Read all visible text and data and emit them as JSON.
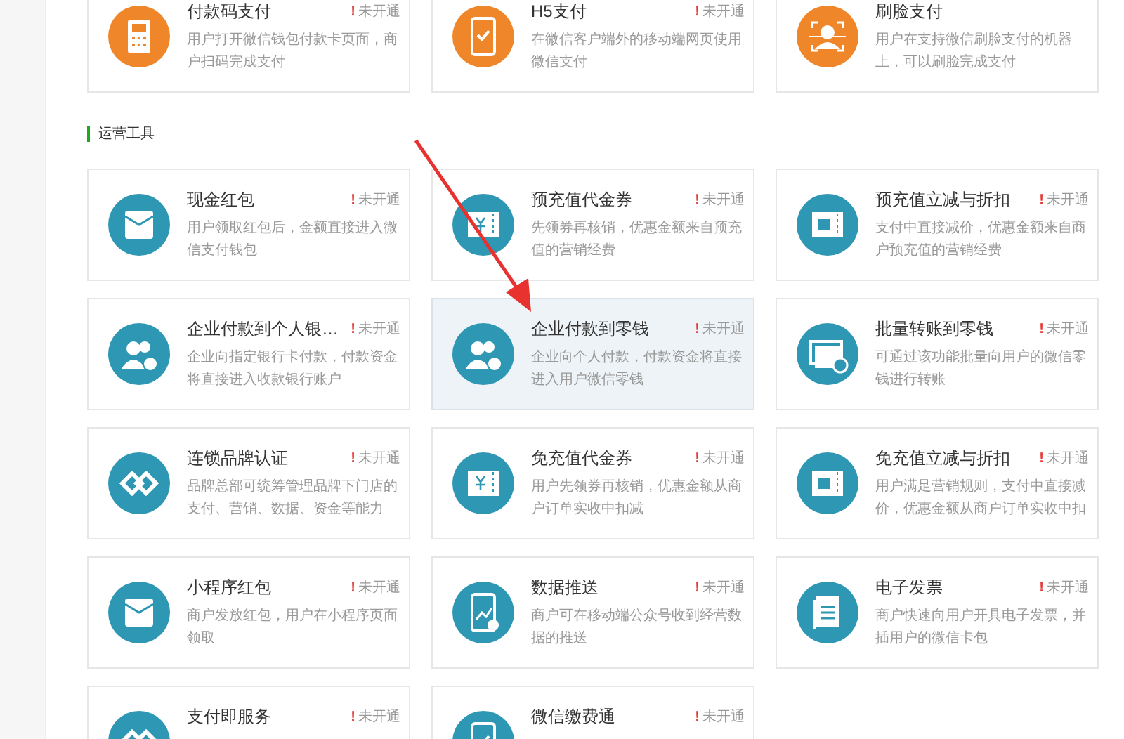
{
  "sections": [
    {
      "color": "#f0862a",
      "cards": [
        {
          "title": "付款码支付",
          "status_mark": "!",
          "status": "未开通",
          "desc": "用户打开微信钱包付款卡页面，商户扫码完成支付",
          "kind": "reader",
          "highlighted": false
        },
        {
          "title": "H5支付",
          "status_mark": "!",
          "status": "未开通",
          "desc": "在微信客户端外的移动端网页使用微信支付",
          "kind": "phone",
          "highlighted": false
        },
        {
          "title": "刷脸支付",
          "desc": "用户在支持微信刷脸支付的机器上，可以刷脸完成支付",
          "kind": "face",
          "highlighted": false
        }
      ]
    },
    {
      "heading": "运营工具",
      "color": "#2e97b3",
      "cards": [
        {
          "title": "现金红包",
          "status_mark": "!",
          "status": "未开通",
          "desc": "用户领取红包后，金额直接进入微信支付钱包",
          "kind": "envelope",
          "highlighted": false
        },
        {
          "title": "预充值代金券",
          "status_mark": "!",
          "status": "未开通",
          "desc": "先领券再核销，优惠金额来自预充值的营销经费",
          "kind": "voucher",
          "highlighted": false
        },
        {
          "title": "预充值立减与折扣",
          "status_mark": "!",
          "status": "未开通",
          "desc": "支付中直接减价，优惠金额来自商户预充值的营销经费",
          "kind": "discount",
          "highlighted": false
        },
        {
          "title": "企业付款到个人银…",
          "status_mark": "!",
          "status": "未开通",
          "desc": "企业向指定银行卡付款，付款资金将直接进入收款银行账户",
          "kind": "people",
          "highlighted": false
        },
        {
          "title": "企业付款到零钱",
          "status_mark": "!",
          "status": "未开通",
          "desc": "企业向个人付款，付款资金将直接进入用户微信零钱",
          "kind": "people",
          "highlighted": true
        },
        {
          "title": "批量转账到零钱",
          "status_mark": "!",
          "status": "未开通",
          "desc": "可通过该功能批量向用户的微信零钱进行转账",
          "kind": "transfer",
          "highlighted": false
        },
        {
          "title": "连锁品牌认证",
          "status_mark": "!",
          "status": "未开通",
          "desc": "品牌总部可统筹管理品牌下门店的支付、营销、数据、资金等能力",
          "kind": "chain",
          "highlighted": false
        },
        {
          "title": "免充值代金券",
          "status_mark": "!",
          "status": "未开通",
          "desc": "用户先领券再核销，优惠金额从商户订单实收中扣减",
          "kind": "voucher",
          "highlighted": false
        },
        {
          "title": "免充值立减与折扣",
          "status_mark": "!",
          "status": "未开通",
          "desc": "用户满足营销规则，支付中直接减价，优惠金额从商户订单实收中扣",
          "kind": "discount",
          "highlighted": false
        },
        {
          "title": "小程序红包",
          "status_mark": "!",
          "status": "未开通",
          "desc": "商户发放红包，用户在小程序页面领取",
          "kind": "envelope",
          "highlighted": false
        },
        {
          "title": "数据推送",
          "status_mark": "!",
          "status": "未开通",
          "desc": "商户可在移动端公众号收到经营数据的推送",
          "kind": "chart",
          "highlighted": false
        },
        {
          "title": "电子发票",
          "status_mark": "!",
          "status": "未开通",
          "desc": "商户快速向用户开具电子发票，并插用户的微信卡包",
          "kind": "invoice",
          "highlighted": false
        },
        {
          "title": "支付即服务",
          "status_mark": "!",
          "status": "未开通",
          "kind": "chain",
          "highlighted": false
        },
        {
          "title": "微信缴费通",
          "status_mark": "!",
          "status": "未开通",
          "kind": "phone",
          "highlighted": false
        }
      ]
    }
  ]
}
